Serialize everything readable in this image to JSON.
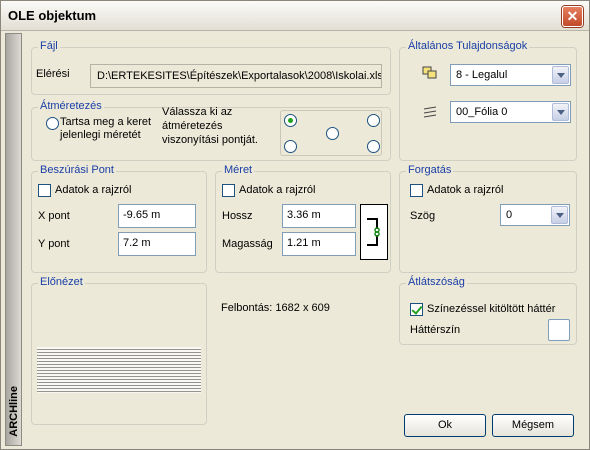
{
  "window": {
    "title": "OLE objektum",
    "close": "✕",
    "sidebar": "ARCHline"
  },
  "file": {
    "legend": "Fájl",
    "path_label": "Elérési",
    "path_value": "D:\\ERTEKESITES\\Építészek\\Exportalasok\\2008\\Iskolai.xls"
  },
  "resize": {
    "legend": "Átméretezés",
    "keep_label": "Tartsa meg a keret jelenlegi méretét",
    "pick_label": "Válassza ki az átméretezés viszonyítási pontját."
  },
  "general": {
    "legend": "Általános Tulajdonságok",
    "pen_value": "8 - Legalul",
    "layer_value": "00_Fólia 0"
  },
  "insert_point": {
    "legend": "Beszúrási Pont",
    "from_drawing": "Adatok a rajzról",
    "x_label": "X pont",
    "x_value": "-9.65 m",
    "y_label": "Y pont",
    "y_value": "7.2 m"
  },
  "size": {
    "legend": "Méret",
    "from_drawing": "Adatok a rajzról",
    "length_label": "Hossz",
    "length_value": "3.36 m",
    "height_label": "Magasság",
    "height_value": "1.21 m"
  },
  "rotation": {
    "legend": "Forgatás",
    "from_drawing": "Adatok a rajzról",
    "angle_label": "Szög",
    "angle_value": "0"
  },
  "preview": {
    "legend": "Előnézet",
    "resolution": "Felbontás: 1682 x 609"
  },
  "transparency": {
    "legend": "Átlátszóság",
    "fill_label": "Színezéssel kitöltött háttér",
    "bg_color_label": "Háttérszín"
  },
  "buttons": {
    "ok": "Ok",
    "cancel": "Mégsem"
  }
}
